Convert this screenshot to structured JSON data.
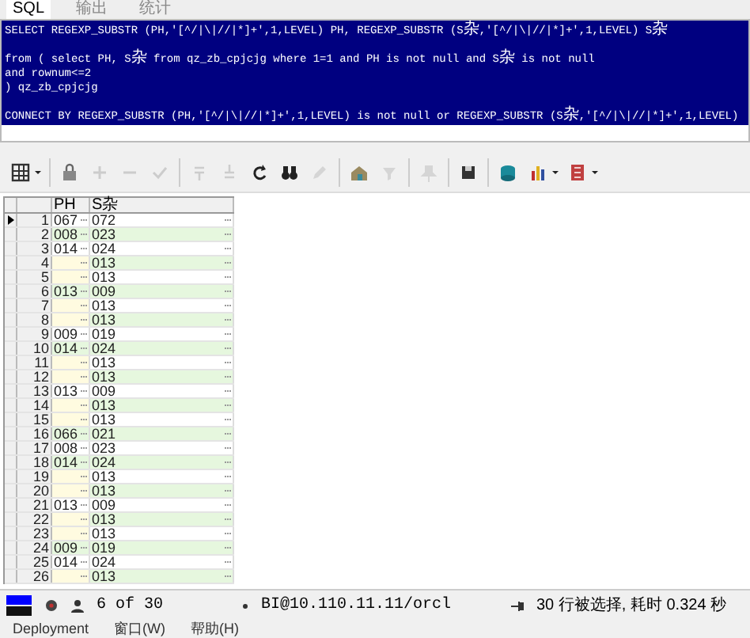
{
  "tabs": [
    {
      "label": "SQL",
      "selected": true
    },
    {
      "label": "输出",
      "selected": false
    },
    {
      "label": "统计",
      "selected": false
    }
  ],
  "editor": {
    "blocks": [
      [
        "SELECT   REGEXP_SUBSTR (PH,'[^/|\\|//|*]+',1,LEVEL) PH, REGEXP_SUBSTR (S杂,'[^/|\\|//|*]+',1,LEVEL) S杂"
      ],
      [
        "from   ( select PH, S杂 from  qz_zb_cpjcjg  where  1=1   and PH is not null and S杂   is not null",
        "and rownum<=2",
        ")  qz_zb_cpjcjg"
      ],
      [
        "CONNECT BY REGEXP_SUBSTR (PH,'[^/|\\|//|*]+',1,LEVEL) is not null or REGEXP_SUBSTR (S杂,'[^/|\\|//|*]+',1,LEVEL)"
      ]
    ]
  },
  "toolbar": [
    {
      "kind": "grid",
      "disabled": false,
      "dropdown": true
    },
    {
      "kind": "sep"
    },
    {
      "kind": "lock",
      "disabled": false
    },
    {
      "kind": "plus",
      "disabled": true
    },
    {
      "kind": "minus",
      "disabled": true
    },
    {
      "kind": "check",
      "disabled": true
    },
    {
      "kind": "sep"
    },
    {
      "kind": "down",
      "disabled": true
    },
    {
      "kind": "up",
      "disabled": true
    },
    {
      "kind": "refresh",
      "disabled": false
    },
    {
      "kind": "binoculars",
      "disabled": false
    },
    {
      "kind": "pencil",
      "disabled": true
    },
    {
      "kind": "sep"
    },
    {
      "kind": "house",
      "disabled": false
    },
    {
      "kind": "filter",
      "disabled": true
    },
    {
      "kind": "sep"
    },
    {
      "kind": "pin",
      "disabled": true
    },
    {
      "kind": "sep"
    },
    {
      "kind": "save",
      "disabled": false
    },
    {
      "kind": "sep"
    },
    {
      "kind": "database",
      "disabled": false
    },
    {
      "kind": "chart",
      "disabled": false,
      "dropdown": true
    },
    {
      "kind": "book",
      "disabled": false,
      "dropdown": true
    }
  ],
  "table": {
    "columns": [
      "PH",
      "S杂"
    ],
    "rows": [
      {
        "number": "1",
        "selected": true,
        "cells": [
          "067",
          "072"
        ]
      },
      {
        "number": "2",
        "selected": false,
        "cells": [
          "008",
          "023"
        ]
      },
      {
        "number": "3",
        "selected": false,
        "cells": [
          "014",
          "024"
        ]
      },
      {
        "number": "4",
        "selected": false,
        "cells": [
          null,
          "013"
        ]
      },
      {
        "number": "5",
        "selected": false,
        "cells": [
          null,
          "013"
        ]
      },
      {
        "number": "6",
        "selected": false,
        "cells": [
          "013",
          "009"
        ]
      },
      {
        "number": "7",
        "selected": false,
        "cells": [
          null,
          "013"
        ]
      },
      {
        "number": "8",
        "selected": false,
        "cells": [
          null,
          "013"
        ]
      },
      {
        "number": "9",
        "selected": false,
        "cells": [
          "009",
          "019"
        ]
      },
      {
        "number": "10",
        "selected": false,
        "cells": [
          "014",
          "024"
        ]
      },
      {
        "number": "11",
        "selected": false,
        "cells": [
          null,
          "013"
        ]
      },
      {
        "number": "12",
        "selected": false,
        "cells": [
          null,
          "013"
        ]
      },
      {
        "number": "13",
        "selected": false,
        "cells": [
          "013",
          "009"
        ]
      },
      {
        "number": "14",
        "selected": false,
        "cells": [
          null,
          "013"
        ]
      },
      {
        "number": "15",
        "selected": false,
        "cells": [
          null,
          "013"
        ]
      },
      {
        "number": "16",
        "selected": false,
        "cells": [
          "066",
          "021"
        ]
      },
      {
        "number": "17",
        "selected": false,
        "cells": [
          "008",
          "023"
        ]
      },
      {
        "number": "18",
        "selected": false,
        "cells": [
          "014",
          "024"
        ]
      },
      {
        "number": "19",
        "selected": false,
        "cells": [
          null,
          "013"
        ]
      },
      {
        "number": "20",
        "selected": false,
        "cells": [
          null,
          "013"
        ]
      },
      {
        "number": "21",
        "selected": false,
        "cells": [
          "013",
          "009"
        ]
      },
      {
        "number": "22",
        "selected": false,
        "cells": [
          null,
          "013"
        ]
      },
      {
        "number": "23",
        "selected": false,
        "cells": [
          null,
          "013"
        ]
      },
      {
        "number": "24",
        "selected": false,
        "cells": [
          "009",
          "019"
        ]
      },
      {
        "number": "25",
        "selected": false,
        "cells": [
          "014",
          "024"
        ]
      },
      {
        "number": "26",
        "selected": false,
        "cells": [
          null,
          "013"
        ]
      }
    ]
  },
  "status_bar": {
    "record": "6 of 30",
    "connection": "BI@10.110.11.11/orcl",
    "message": "30 行被选择, 耗时 0.324 秒"
  },
  "menu": [
    "Deployment",
    "窗口(W)",
    "帮助(H)"
  ]
}
